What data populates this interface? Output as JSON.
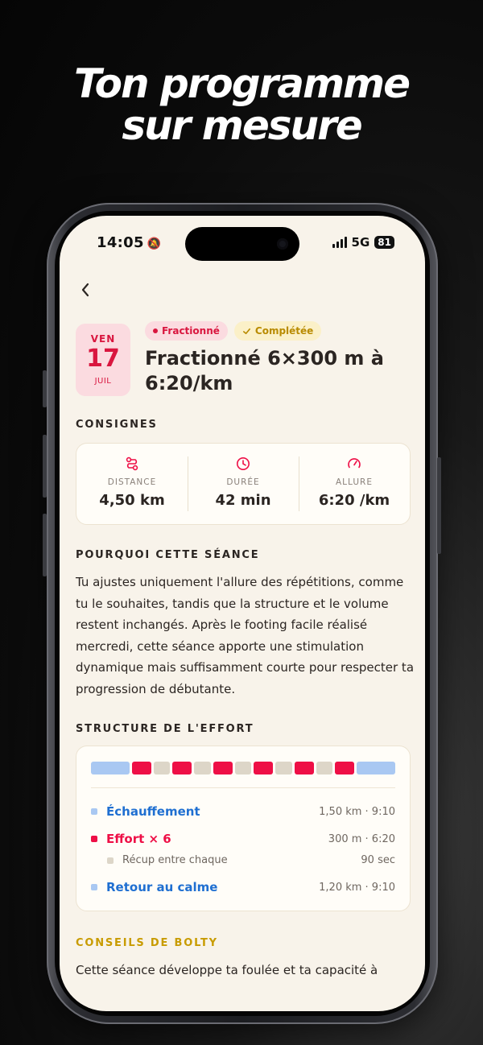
{
  "headline": {
    "line1": "Ton programme",
    "line2": "sur mesure"
  },
  "status_bar": {
    "time": "14:05",
    "network": "5G",
    "battery": "81"
  },
  "session": {
    "date": {
      "weekday": "VEN",
      "day": "17",
      "month": "JUIL"
    },
    "type_tag": "Fractionné",
    "status_tag": "Complétée",
    "title": "Fractionné 6×300 m à 6:20/km"
  },
  "consignes": {
    "label": "CONSIGNES",
    "metrics": [
      {
        "icon": "route-icon",
        "label": "DISTANCE",
        "value": "4,50 km"
      },
      {
        "icon": "clock-icon",
        "label": "DURÉE",
        "value": "42 min"
      },
      {
        "icon": "speedometer-icon",
        "label": "ALLURE",
        "value": "6:20 /km"
      }
    ]
  },
  "why": {
    "label": "POURQUOI CETTE SÉANCE",
    "text": "Tu ajustes uniquement l'allure des répétitions, comme tu le souhaites, tandis que la structure et le volume restent inchangés. Après le footing facile réalisé mercredi, cette séance apporte une stimulation dynamique mais suffisamment courte pour respecter ta progression de débutante."
  },
  "effort": {
    "label": "STRUCTURE DE L'EFFORT",
    "segments": [
      "warmup",
      "effort",
      "recovery",
      "effort",
      "recovery",
      "effort",
      "recovery",
      "effort",
      "recovery",
      "effort",
      "recovery",
      "effort",
      "cooldown"
    ],
    "rows": [
      {
        "name": "Échauffement",
        "value": "1,50 km · 9:10",
        "kind": "warmup"
      },
      {
        "name": "Effort × 6",
        "value": "300 m · 6:20",
        "kind": "effort"
      },
      {
        "name": "Récup entre chaque",
        "value": "90 sec",
        "kind": "recovery"
      },
      {
        "name": "Retour au calme",
        "value": "1,20 km · 9:10",
        "kind": "cooldown"
      }
    ]
  },
  "tips": {
    "label": "CONSEILS DE BOLTY",
    "text": "Cette séance développe ta foulée et ta capacité à"
  },
  "colors": {
    "warmup": "#a9c8f2",
    "effort": "#ee0f46",
    "recovery": "#ddd6c8",
    "cooldown": "#a9c8f2",
    "accent_pink": "#d9163f",
    "accent_blue": "#1f6fd1",
    "accent_gold": "#c89b00"
  }
}
